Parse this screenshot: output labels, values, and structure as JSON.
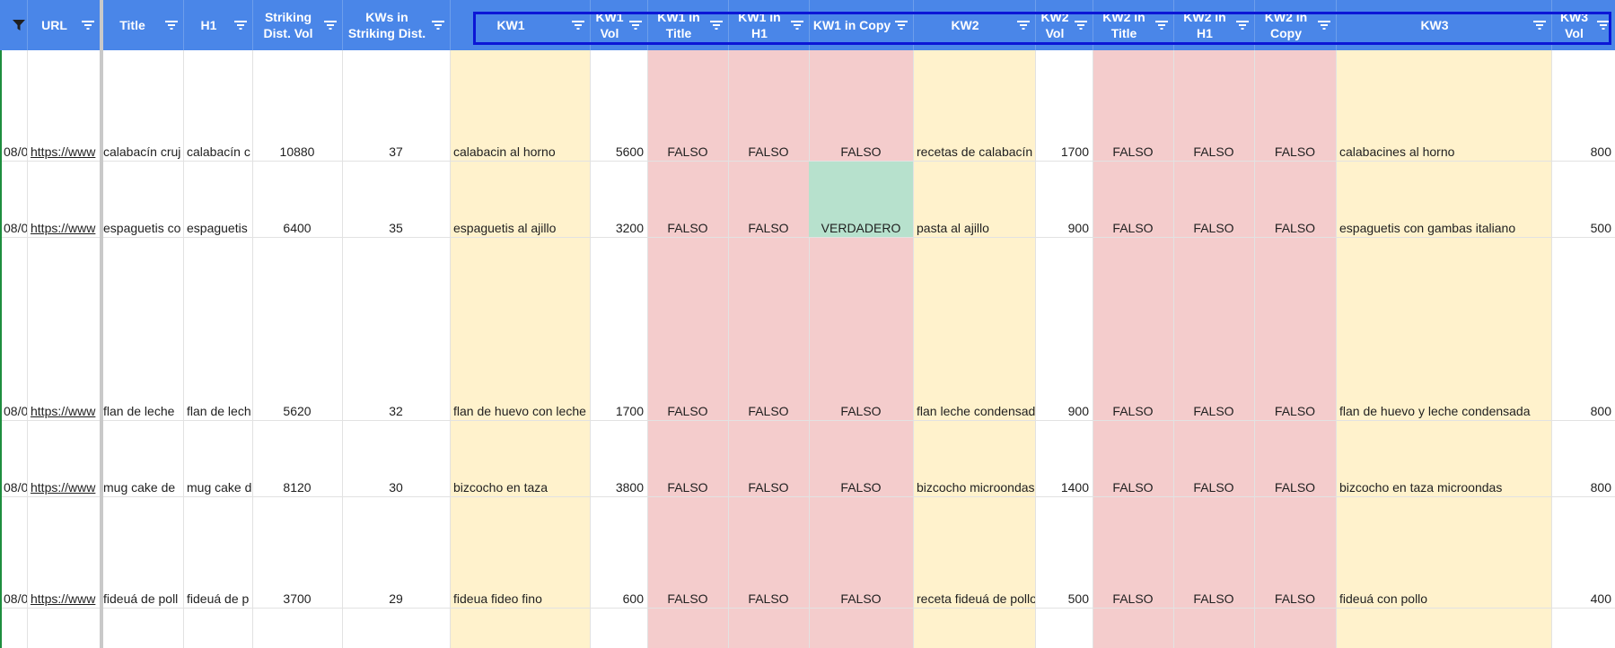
{
  "colors": {
    "header_bg": "#4a86e8",
    "header_text": "#ffffff",
    "selection_border": "#0b16d6",
    "yellow_fill": "#fff2cc",
    "red_fill": "#f4cccc",
    "green_fill": "#b7e1cd"
  },
  "columns": [
    {
      "key": "date",
      "label": "",
      "w": 30,
      "fill": "",
      "align": "left",
      "link": false
    },
    {
      "key": "url",
      "label": "URL",
      "w": 81,
      "fill": "",
      "align": "left",
      "link": true
    },
    {
      "key": "title",
      "label": "Title",
      "w": 93,
      "fill": "",
      "align": "left",
      "link": false
    },
    {
      "key": "h1",
      "label": "H1",
      "w": 77,
      "fill": "",
      "align": "left",
      "link": false
    },
    {
      "key": "sdv",
      "label": "Striking Dist. Vol",
      "w": 100,
      "fill": "",
      "align": "center",
      "link": false
    },
    {
      "key": "kwsd",
      "label": "KWs in Striking Dist.",
      "w": 120,
      "fill": "",
      "align": "center",
      "link": false
    },
    {
      "key": "kw1",
      "label": "KW1",
      "w": 156,
      "fill": "yellow_fill",
      "align": "left",
      "link": false
    },
    {
      "key": "kw1vol",
      "label": "KW1 Vol",
      "w": 64,
      "fill": "",
      "align": "right",
      "link": false
    },
    {
      "key": "kw1title",
      "label": "KW1 in Title",
      "w": 90,
      "fill": "red_fill",
      "align": "center",
      "link": false
    },
    {
      "key": "kw1h1",
      "label": "KW1 in H1",
      "w": 90,
      "fill": "red_fill",
      "align": "center",
      "link": false
    },
    {
      "key": "kw1copy",
      "label": "KW1 in Copy",
      "w": 116,
      "fill": "red_fill",
      "align": "center",
      "link": false
    },
    {
      "key": "kw2",
      "label": "KW2",
      "w": 136,
      "fill": "yellow_fill",
      "align": "left",
      "link": false
    },
    {
      "key": "kw2vol",
      "label": "KW2 Vol",
      "w": 64,
      "fill": "",
      "align": "right",
      "link": false
    },
    {
      "key": "kw2title",
      "label": "KW2 in Title",
      "w": 90,
      "fill": "red_fill",
      "align": "center",
      "link": false
    },
    {
      "key": "kw2h1",
      "label": "KW2 in H1",
      "w": 90,
      "fill": "red_fill",
      "align": "center",
      "link": false
    },
    {
      "key": "kw2copy",
      "label": "KW2 in Copy",
      "w": 91,
      "fill": "red_fill",
      "align": "center",
      "link": false
    },
    {
      "key": "kw3",
      "label": "KW3",
      "w": 240,
      "fill": "yellow_fill",
      "align": "left",
      "link": false
    },
    {
      "key": "kw3vol",
      "label": "KW3 Vol",
      "w": 71,
      "fill": "",
      "align": "right",
      "link": false
    }
  ],
  "rows": [
    {
      "h": 124,
      "cells": {
        "date": "08/0",
        "url": "https://www",
        "title": "calabacín cruj",
        "h1": "calabacín c",
        "sdv": "10880",
        "kwsd": "37",
        "kw1": "calabacin al horno",
        "kw1vol": "5600",
        "kw1title": "FALSO",
        "kw1h1": "FALSO",
        "kw1copy": "FALSO",
        "kw2": "recetas de calabacín",
        "kw2vol": "1700",
        "kw2title": "FALSO",
        "kw2h1": "FALSO",
        "kw2copy": "FALSO",
        "kw3": "calabacines al horno",
        "kw3vol": "800"
      },
      "green": []
    },
    {
      "h": 85,
      "cells": {
        "date": "08/0",
        "url": "https://www",
        "title": "espaguetis co",
        "h1": "espaguetis",
        "sdv": "6400",
        "kwsd": "35",
        "kw1": "espaguetis al ajillo",
        "kw1vol": "3200",
        "kw1title": "FALSO",
        "kw1h1": "FALSO",
        "kw1copy": "VERDADERO",
        "kw2": "pasta al ajillo",
        "kw2vol": "900",
        "kw2title": "FALSO",
        "kw2h1": "FALSO",
        "kw2copy": "FALSO",
        "kw3": "espaguetis con gambas italiano",
        "kw3vol": "500"
      },
      "green": [
        "kw1copy"
      ]
    },
    {
      "h": 204,
      "cells": {
        "date": "08/0",
        "url": "https://www",
        "title": "flan de leche",
        "h1": "flan de lech",
        "sdv": "5620",
        "kwsd": "32",
        "kw1": "flan de huevo con leche",
        "kw1vol": "1700",
        "kw1title": "FALSO",
        "kw1h1": "FALSO",
        "kw1copy": "FALSO",
        "kw2": "flan leche condensada",
        "kw2vol": "900",
        "kw2title": "FALSO",
        "kw2h1": "FALSO",
        "kw2copy": "FALSO",
        "kw3": "flan de huevo y leche condensada",
        "kw3vol": "800"
      },
      "green": []
    },
    {
      "h": 85,
      "cells": {
        "date": "08/0",
        "url": "https://www",
        "title": "mug cake de",
        "h1": "mug cake d",
        "sdv": "8120",
        "kwsd": "30",
        "kw1": "bizcocho en taza",
        "kw1vol": "3800",
        "kw1title": "FALSO",
        "kw1h1": "FALSO",
        "kw1copy": "FALSO",
        "kw2": "bizcocho microondas",
        "kw2vol": "1400",
        "kw2title": "FALSO",
        "kw2h1": "FALSO",
        "kw2copy": "FALSO",
        "kw3": "bizcocho en taza microondas",
        "kw3vol": "800"
      },
      "green": []
    },
    {
      "h": 124,
      "cells": {
        "date": "08/0",
        "url": "https://www",
        "title": "fideuá de poll",
        "h1": "fideuá de p",
        "sdv": "3700",
        "kwsd": "29",
        "kw1": "fideua fideo fino",
        "kw1vol": "600",
        "kw1title": "FALSO",
        "kw1h1": "FALSO",
        "kw1copy": "FALSO",
        "kw2": "receta fideuá de pollo",
        "kw2vol": "500",
        "kw2title": "FALSO",
        "kw2h1": "FALSO",
        "kw2copy": "FALSO",
        "kw3": "fideuá con pollo",
        "kw3vol": "400"
      },
      "green": []
    }
  ]
}
